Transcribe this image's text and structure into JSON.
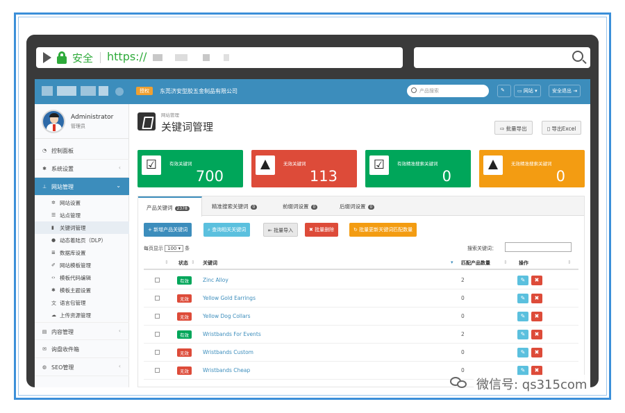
{
  "browser": {
    "secure_label": "安全",
    "url_prefix": "https://",
    "search_icon": "search-icon"
  },
  "topbar": {
    "auth_badge": "授权",
    "company": "东莞济安型胶五金制品有限公司",
    "search_placeholder": "产品搜索",
    "site_label": "网站",
    "logout_label": "安全退出"
  },
  "user": {
    "name": "Administrator",
    "role": "管理员"
  },
  "sidebar": {
    "items": [
      {
        "label": "控制面板",
        "icon": "dashboard-icon"
      },
      {
        "label": "系统设置",
        "icon": "gear-icon"
      },
      {
        "label": "网站管理",
        "icon": "sitemap-icon"
      },
      {
        "label": "内容管理",
        "icon": "folder-icon"
      },
      {
        "label": "询盘收件箱",
        "icon": "inbox-icon"
      },
      {
        "label": "SEO管理",
        "icon": "globe-icon"
      }
    ],
    "sub_items": [
      {
        "label": "网站设置",
        "icon": "cogs-icon"
      },
      {
        "label": "站点管理",
        "icon": "list-icon"
      },
      {
        "label": "关键词管理",
        "icon": "book-icon"
      },
      {
        "label": "动态着陆页（DLP）",
        "icon": "circle-icon"
      },
      {
        "label": "数据库设置",
        "icon": "database-icon"
      },
      {
        "label": "网站模板管理",
        "icon": "brush-icon"
      },
      {
        "label": "模板代码编辑",
        "icon": "code-icon"
      },
      {
        "label": "模板主题设置",
        "icon": "gear-icon"
      },
      {
        "label": "语言包管理",
        "icon": "language-icon"
      },
      {
        "label": "上传资源管理",
        "icon": "cloud-icon"
      }
    ]
  },
  "page": {
    "breadcrumb": "网站管理",
    "title": "关键词管理",
    "export_batch": "批量导出",
    "export_excel": "导出Excel"
  },
  "stats": [
    {
      "label": "有效关键词",
      "value": "700",
      "color": "#00a65a"
    },
    {
      "label": "无效关键词",
      "value": "113",
      "color": "#dd4b39"
    },
    {
      "label": "有效精准搜索关键词",
      "value": "0",
      "color": "#00a65a"
    },
    {
      "label": "无效精准搜索关键词",
      "value": "0",
      "color": "#f39c12"
    }
  ],
  "tabs": [
    {
      "label": "产品关键词",
      "count": "2378"
    },
    {
      "label": "精准搜索关键词",
      "count": "0"
    },
    {
      "label": "前缀词设置",
      "count": "0"
    },
    {
      "label": "后缀词设置",
      "count": "0"
    }
  ],
  "actions": {
    "add": "+ 新增产品关键词",
    "find": "查询相关关键词",
    "import": "批量导入",
    "delete": "批量删除",
    "refresh": "批量更新关键词匹配数量"
  },
  "list": {
    "per_page_prefix": "每页显示",
    "per_page_value": "100",
    "per_page_suffix": "条",
    "search_label": "搜索关键词："
  },
  "table": {
    "headers": {
      "status": "状态",
      "keyword": "关键词",
      "count": "匹配产品数量",
      "ops": "操作"
    },
    "rows": [
      {
        "status": "有效",
        "keyword": "Zinc Alloy",
        "count": "2"
      },
      {
        "status": "无效",
        "keyword": "Yellow Gold Earrings",
        "count": "0"
      },
      {
        "status": "无效",
        "keyword": "Yellow Dog Collars",
        "count": "0"
      },
      {
        "status": "有效",
        "keyword": "Wristbands For Events",
        "count": "2"
      },
      {
        "status": "无效",
        "keyword": "Wristbands Custom",
        "count": "0"
      },
      {
        "status": "无效",
        "keyword": "Wristbands Cheap",
        "count": "0"
      }
    ]
  },
  "colors": {
    "primary": "#3c8dbc",
    "success": "#00a65a",
    "danger": "#dd4b39",
    "warning": "#f39c12",
    "info": "#5bc0de"
  },
  "watermark": "微信号: qs315com"
}
